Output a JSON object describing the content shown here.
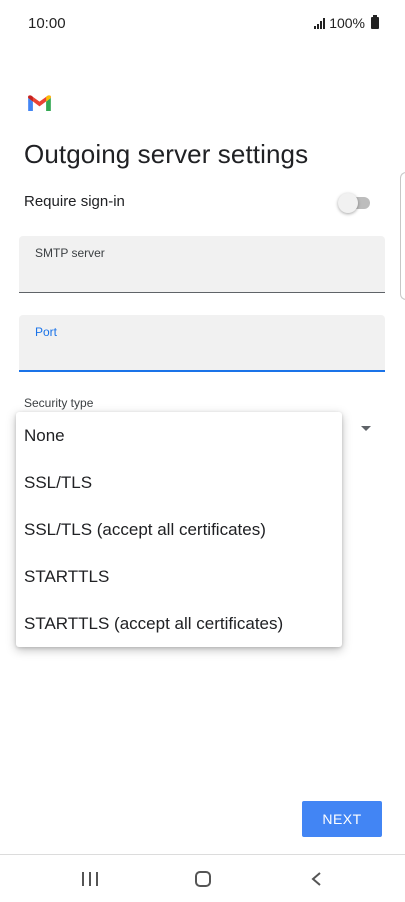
{
  "status_bar": {
    "time": "10:00",
    "battery_text": "100%"
  },
  "app": {
    "logo_icon": "gmail-icon",
    "title": "Outgoing server settings"
  },
  "require_signin": {
    "label": "Require sign-in",
    "enabled": false
  },
  "smtp_field": {
    "label": "SMTP server",
    "value": ""
  },
  "port_field": {
    "label": "Port",
    "value": "",
    "focused": true
  },
  "security_type": {
    "label": "Security type",
    "options": [
      "None",
      "SSL/TLS",
      "SSL/TLS (accept all certificates)",
      "STARTTLS",
      "STARTTLS (accept all certificates)"
    ]
  },
  "next_button": {
    "label": "NEXT"
  },
  "colors": {
    "accent": "#1a73e8",
    "button": "#4285f4",
    "field_bg": "#f1f1f1"
  },
  "nav": {
    "recents_icon": "recents-icon",
    "home_icon": "home-icon",
    "back_icon": "back-icon"
  }
}
